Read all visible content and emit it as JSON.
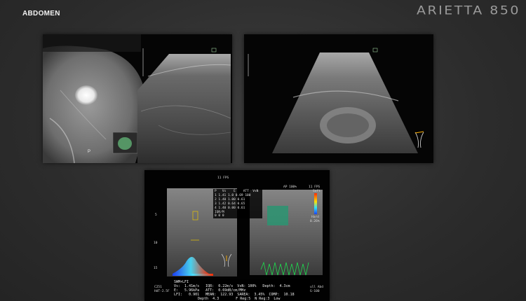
{
  "header": {
    "section": "ABDOMEN",
    "brand": "ARIETTA 850"
  },
  "panel_top_left": {
    "ct_side_label": "P",
    "fps_icon": "probe-icon"
  },
  "panel_top_right": {
    "fps_icon": "probe-icon"
  },
  "panel_bottom": {
    "fps_left": "11 FPS",
    "fps_right": "11 FPS",
    "ap_label": "AP 100%",
    "scale_soft": "Soft",
    "scale_hard": "Hard",
    "scale_pct": "0.26%",
    "depth_marks": [
      "5",
      "10",
      "15"
    ],
    "meas_header": [
      "P",
      "Vs",
      "E",
      "ATT",
      "VsN"
    ],
    "meas_rows": [
      "1  1.41 1.0 0.69 100",
      "2  1.40 1.00 0.61",
      "3  1.42 0.64 0.65",
      "4  1.40 0.00 0.61"
    ],
    "meas_extra": "IQR/M",
    "meas_zero": "0     0     0",
    "left_corner_1": "C251",
    "left_corner_2": "HdT-2.5F",
    "right_corner_1": "ull Abd",
    "right_corner_2": "G-100",
    "stat_title": "SWM+LFI",
    "stats": [
      "Vs:  1.41m/s   IQR:  0.22m/s  VsN: 100%   Depth:  4.3cm",
      "E:   5.96kPa   ATT:  0.69dB/cm/MHz",
      "LFI:   0.901   MEAN:  122.93  SAREA:  3.45%  COMP:  10.18"
    ],
    "bottom_line": "Depth  4.3        F Reg:5  N Reg:3  Low"
  }
}
